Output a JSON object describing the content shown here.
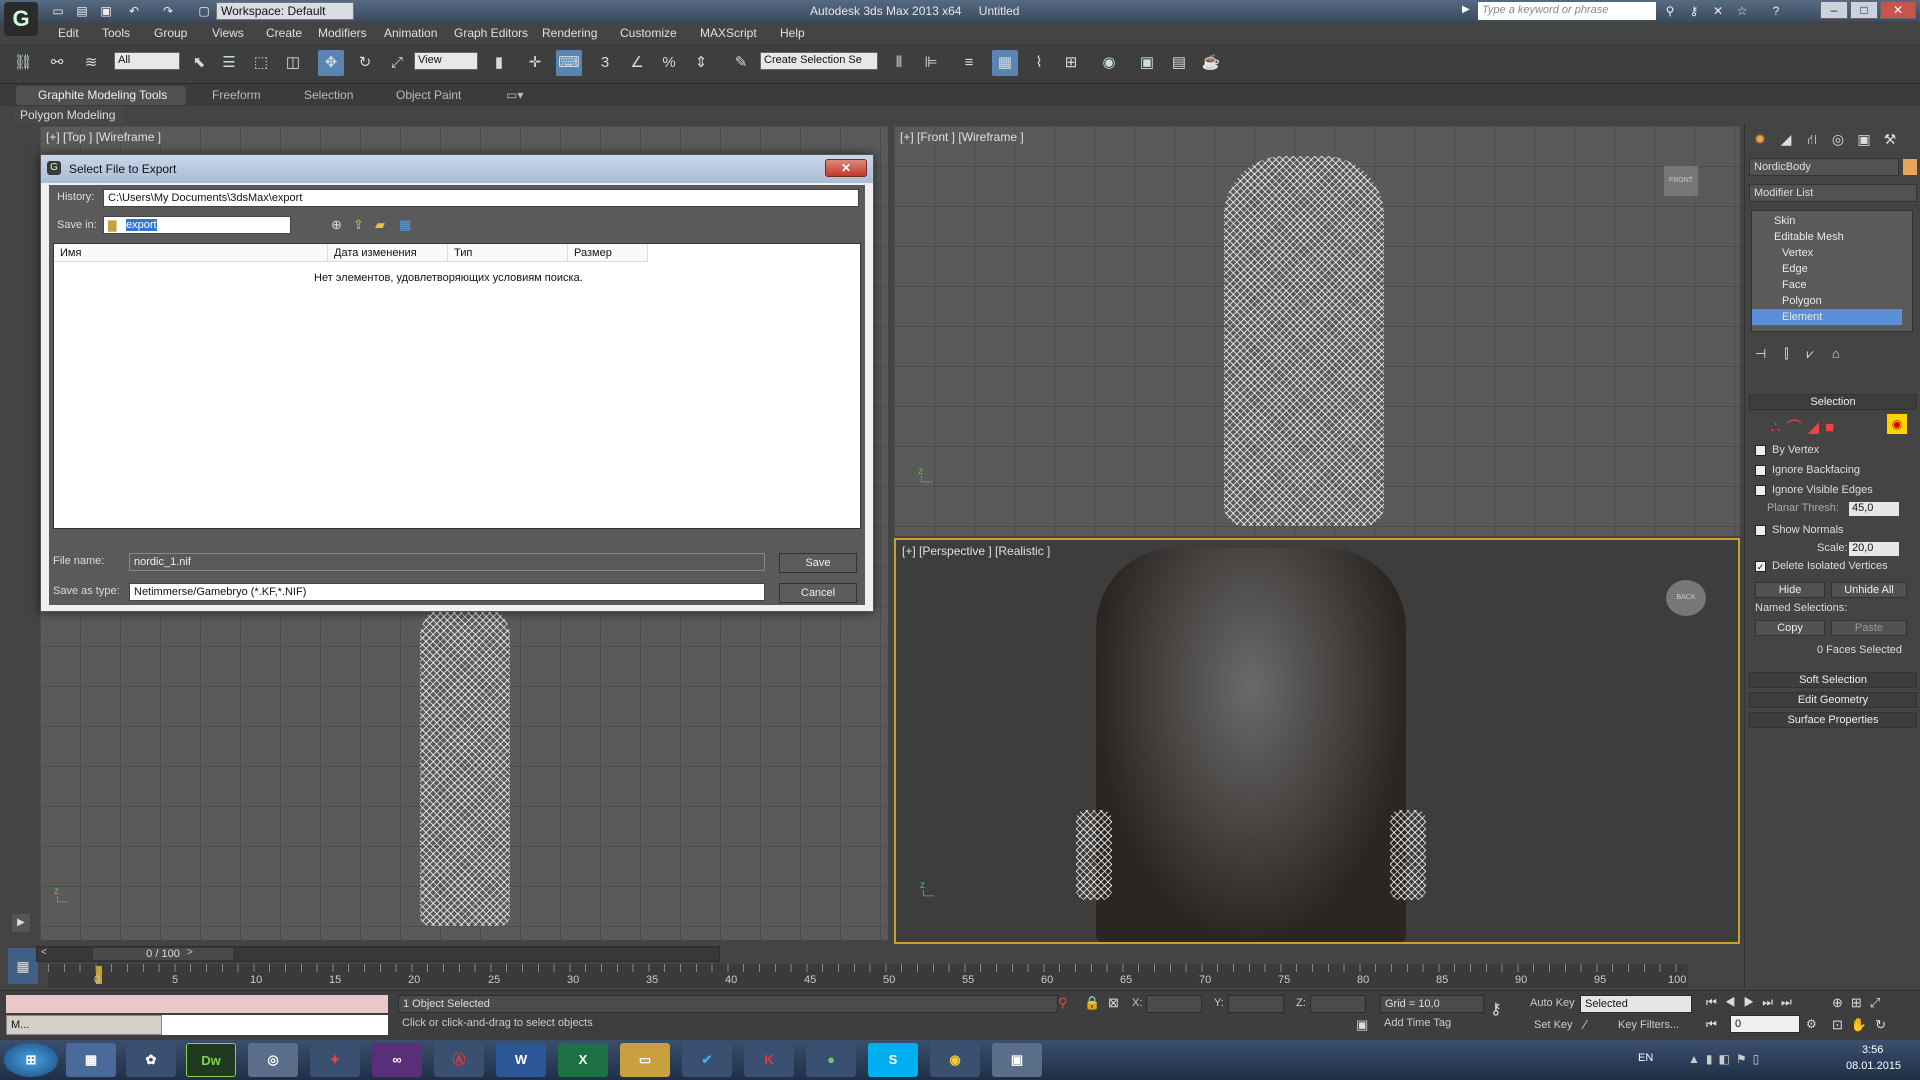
{
  "titlebar": {
    "workspace": "Workspace: Default",
    "app_name": "Autodesk 3ds Max  2013 x64",
    "doc_name": "Untitled",
    "search_placeholder": "Type a keyword or phrase",
    "min": "–",
    "max": "□",
    "close": "✕"
  },
  "menu": [
    "Edit",
    "Tools",
    "Group",
    "Views",
    "Create",
    "Modifiers",
    "Animation",
    "Graph Editors",
    "Rendering",
    "Customize",
    "MAXScript",
    "Help"
  ],
  "toolbar": {
    "filter": "All",
    "coord_system": "View",
    "selection_set": "Create Selection Se"
  },
  "ribbon": {
    "tabs": [
      "Graphite Modeling Tools",
      "Freeform",
      "Selection",
      "Object Paint"
    ],
    "sub": "Polygon Modeling"
  },
  "viewports": {
    "top": "[+] [Top ] [Wireframe ]",
    "front": "[+] [Front ] [Wireframe ]",
    "perspective": "[+] [Perspective ] [Realistic ]",
    "viewcube_front": "FRONT",
    "viewcube_back": "BACK"
  },
  "command_panel": {
    "object_name": "NordicBody",
    "modifier_list": "Modifier List",
    "stack": [
      "Skin",
      "Editable Mesh",
      "Vertex",
      "Edge",
      "Face",
      "Polygon",
      "Element"
    ],
    "selection_title": "Selection",
    "by_vertex": "By Vertex",
    "ignore_backfacing": "Ignore Backfacing",
    "ignore_visible_edges": "Ignore Visible Edges",
    "planar_thresh_label": "Planar Thresh:",
    "planar_thresh_value": "45,0",
    "show_normals": "Show Normals",
    "scale_label": "Scale:",
    "scale_value": "20,0",
    "delete_isolated": "Delete Isolated Vertices",
    "hide": "Hide",
    "unhide_all": "Unhide All",
    "named_selections": "Named Selections:",
    "copy": "Copy",
    "paste": "Paste",
    "faces_selected": "0 Faces Selected",
    "rollouts": [
      "Soft Selection",
      "Edit Geometry",
      "Surface Properties"
    ]
  },
  "timeline": {
    "frame": "0 / 100",
    "ticks": [
      "0",
      "5",
      "10",
      "15",
      "20",
      "25",
      "30",
      "35",
      "40",
      "45",
      "50",
      "55",
      "60",
      "65",
      "70",
      "75",
      "80",
      "85",
      "90",
      "95",
      "100"
    ]
  },
  "status": {
    "objects": "1 Object Selected",
    "prompt": "Click or click-and-drag to select objects",
    "x_label": "X:",
    "y_label": "Y:",
    "z_label": "Z:",
    "grid": "Grid = 10,0",
    "add_time_tag": "Add Time Tag",
    "auto_key": "Auto Key",
    "set_key": "Set Key",
    "key_mode": "Selected",
    "key_filters": "Key Filters...",
    "frame_field": "0",
    "mini_label": "M..."
  },
  "dialog": {
    "title": "Select File to Export",
    "history_label": "History:",
    "history_value": "C:\\Users\\My Documents\\3dsMax\\export",
    "save_in_label": "Save in:",
    "save_in_value": "export",
    "columns": [
      "Имя",
      "Дата изменения",
      "Тип",
      "Размер"
    ],
    "empty_message": "Нет элементов, удовлетворяющих условиям поиска.",
    "file_name_label": "File name:",
    "file_name_value": "nordic_1.nif",
    "save_as_label": "Save as type:",
    "save_as_value": "Netimmerse/Gamebryo (*.KF,*.NIF)",
    "save_btn": "Save",
    "cancel_btn": "Cancel"
  },
  "taskbar": {
    "apps": [
      "start",
      "explorer",
      "chrome-like",
      "Dw",
      "3dsmax",
      "app5",
      "VS",
      "app7",
      "W",
      "X",
      "folder",
      "app11",
      "K",
      "app13",
      "S",
      "chrome",
      "app16"
    ],
    "dw_text": "Dw",
    "word_text": "W",
    "excel_text": "X",
    "lang": "EN",
    "time": "3:56",
    "date": "08.01.2015"
  },
  "colors": {
    "accent": "#5a84b4",
    "viewport_border": "#c9a227",
    "selected_item": "#5b8fd6"
  }
}
